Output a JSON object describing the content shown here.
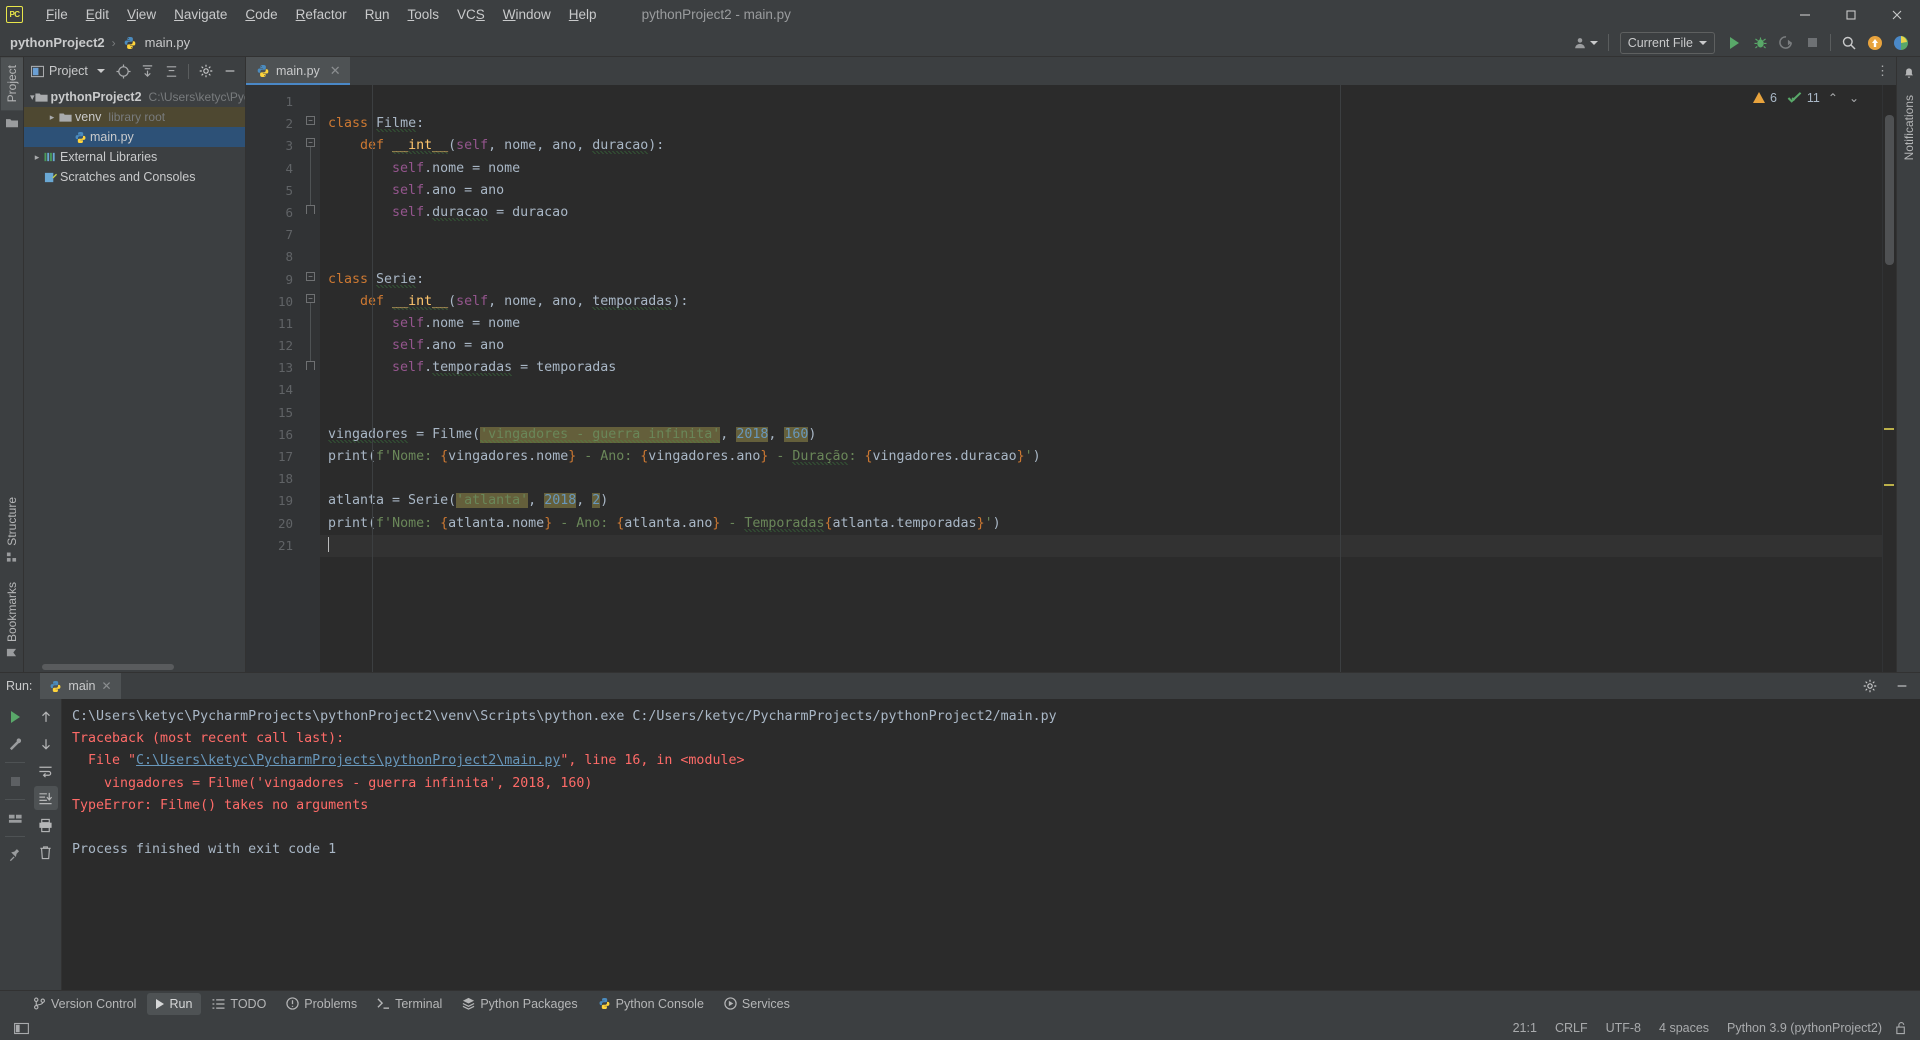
{
  "window": {
    "title": "pythonProject2 - main.py",
    "minimize_label": "–",
    "maximize_label": "❐",
    "close_label": "✕",
    "logo_text": "PC"
  },
  "menubar": {
    "items": [
      {
        "label": "File",
        "mnemonic": "F"
      },
      {
        "label": "Edit",
        "mnemonic": "E"
      },
      {
        "label": "View",
        "mnemonic": "V"
      },
      {
        "label": "Navigate",
        "mnemonic": "N"
      },
      {
        "label": "Code",
        "mnemonic": "C"
      },
      {
        "label": "Refactor",
        "mnemonic": "R"
      },
      {
        "label": "Run",
        "mnemonic": "u"
      },
      {
        "label": "Tools",
        "mnemonic": "T"
      },
      {
        "label": "VCS",
        "mnemonic": "S"
      },
      {
        "label": "Window",
        "mnemonic": "W"
      },
      {
        "label": "Help",
        "mnemonic": "H"
      }
    ]
  },
  "breadcrumb": {
    "project": "pythonProject2",
    "separator": "›",
    "file": "main.py"
  },
  "toolbar": {
    "run_configuration": "Current File",
    "buttons": [
      "run",
      "debug",
      "run-with-coverage",
      "stop",
      "search",
      "updates",
      "ide-feature"
    ]
  },
  "left_rail": {
    "project_tab": "Project",
    "structure_tab": "Structure",
    "bookmarks_tab": "Bookmarks"
  },
  "right_rail": {
    "notifications_tab": "Notifications"
  },
  "project_panel": {
    "title": "Project",
    "tree": [
      {
        "label": "pythonProject2",
        "hint": "C:\\Users\\ketyc\\Pycharm",
        "indent": 0,
        "twisty": "expanded",
        "icon": "folder-icon",
        "bold": true,
        "state": "none"
      },
      {
        "label": "venv",
        "hint": "library root",
        "indent": 1,
        "twisty": "collapsed",
        "icon": "folder-icon",
        "bold": false,
        "state": "venv"
      },
      {
        "label": "main.py",
        "hint": "",
        "indent": 2,
        "twisty": "none",
        "icon": "python-file-icon",
        "bold": false,
        "state": "selected"
      },
      {
        "label": "External Libraries",
        "hint": "",
        "indent": 0,
        "twisty": "collapsed",
        "icon": "libraries-icon",
        "bold": false,
        "state": "none"
      },
      {
        "label": "Scratches and Consoles",
        "hint": "",
        "indent": 0,
        "twisty": "none",
        "icon": "scratches-icon",
        "bold": false,
        "state": "none"
      }
    ]
  },
  "editor": {
    "tab": {
      "label": "main.py",
      "close": "✕"
    },
    "inspections": {
      "warning_count": "6",
      "ok_count": "11",
      "up": "⌃",
      "down": "⌄"
    },
    "lines": [
      {
        "n": "1",
        "html": ""
      },
      {
        "n": "2",
        "html": "<span class=\"kw\">class</span> <span class=\"cls sq\">Filme</span>:"
      },
      {
        "n": "3",
        "html": "    <span class=\"kw\">def</span> <span class=\"fn sq\">__int__</span>(<span class=\"self\">self</span>, nome, ano, <span class=\"sq\">duracao</span>):"
      },
      {
        "n": "4",
        "html": "        <span class=\"self\">self</span>.nome = nome"
      },
      {
        "n": "5",
        "html": "        <span class=\"self\">self</span>.ano = ano"
      },
      {
        "n": "6",
        "html": "        <span class=\"self\">self</span>.<span class=\"sq\">duracao</span> = duracao"
      },
      {
        "n": "7",
        "html": ""
      },
      {
        "n": "8",
        "html": ""
      },
      {
        "n": "9",
        "html": "<span class=\"kw\">class</span> <span class=\"cls sq\">Serie</span>:"
      },
      {
        "n": "10",
        "html": "    <span class=\"kw\">def</span> <span class=\"fn sq\">__int__</span>(<span class=\"self\">self</span>, nome, ano, <span class=\"sq\">temporadas</span>):"
      },
      {
        "n": "11",
        "html": "        <span class=\"self\">self</span>.nome = nome"
      },
      {
        "n": "12",
        "html": "        <span class=\"self\">self</span>.ano = ano"
      },
      {
        "n": "13",
        "html": "        <span class=\"self\">self</span>.<span class=\"sq\">temporadas</span> = temporadas"
      },
      {
        "n": "14",
        "html": ""
      },
      {
        "n": "15",
        "html": ""
      },
      {
        "n": "16",
        "html": "<span class=\"sq\">vingadores</span> = Filme(<span class=\"str hl sq\">'vingadores - guerra infinita'</span><span class=\"punc\">,</span> <span class=\"num hl\">2018</span><span class=\"punc\">,</span> <span class=\"num hl\">160</span>)"
      },
      {
        "n": "17",
        "html": "print(<span class=\"str\">f'</span><span class=\"str\">Nome: </span><span class=\"fstr-brace\">{</span>vingadores.nome<span class=\"fstr-brace\">}</span><span class=\"str\"> - Ano: </span><span class=\"fstr-brace\">{</span>vingadores.ano<span class=\"fstr-brace\">}</span><span class=\"str\"> - </span><span class=\"str sq\">Duração</span><span class=\"str\">: </span><span class=\"fstr-brace\">{</span>vingadores.duracao<span class=\"fstr-brace\">}</span><span class=\"str\">'</span>)"
      },
      {
        "n": "18",
        "html": ""
      },
      {
        "n": "19",
        "html": "atlanta = Serie(<span class=\"str hl\">'atlanta'</span><span class=\"punc\">,</span> <span class=\"num hl\">2018</span><span class=\"punc\">,</span> <span class=\"num hl\">2</span>)"
      },
      {
        "n": "20",
        "html": "print(<span class=\"str\">f'</span><span class=\"str\">Nome: </span><span class=\"fstr-brace\">{</span>atlanta.nome<span class=\"fstr-brace\">}</span><span class=\"str\"> - Ano: </span><span class=\"fstr-brace\">{</span>atlanta.ano<span class=\"fstr-brace\">}</span><span class=\"str\"> - </span><span class=\"str sq\">Temporadas</span><span class=\"fstr-brace\">{</span>atlanta.temporadas<span class=\"fstr-brace\">}</span><span class=\"str\">'</span>)"
      },
      {
        "n": "21",
        "html": "",
        "current": true
      }
    ]
  },
  "run_window": {
    "label": "Run:",
    "tab": "main",
    "tab_close": "✕",
    "settings_icon": "gear-icon",
    "minimize_icon": "minimize-icon",
    "console": [
      {
        "text": "C:\\Users\\ketyc\\PycharmProjects\\pythonProject2\\venv\\Scripts\\python.exe C:/Users/ketyc/PycharmProjects/pythonProject2/main.py",
        "type": "normal"
      },
      {
        "text": "Traceback (most recent call last):",
        "type": "error"
      },
      {
        "text": "  File \"C:\\Users\\ketyc\\PycharmProjects\\pythonProject2\\main.py\", line 16, in <module>",
        "type": "error-link",
        "prefix": "  File \"",
        "link": "C:\\Users\\ketyc\\PycharmProjects\\pythonProject2\\main.py",
        "suffix": "\", line 16, in <module>"
      },
      {
        "text": "    vingadores = Filme('vingadores - guerra infinita', 2018, 160)",
        "type": "error"
      },
      {
        "text": "TypeError: Filme() takes no arguments",
        "type": "error"
      },
      {
        "text": "",
        "type": "normal"
      },
      {
        "text": "Process finished with exit code 1",
        "type": "normal"
      }
    ]
  },
  "tool_window_bar": {
    "items": [
      {
        "label": "Version Control",
        "icon": "branch-icon",
        "active": false
      },
      {
        "label": "Run",
        "icon": "run-icon",
        "active": true
      },
      {
        "label": "TODO",
        "icon": "todo-icon",
        "active": false
      },
      {
        "label": "Problems",
        "icon": "problems-icon",
        "active": false
      },
      {
        "label": "Terminal",
        "icon": "terminal-icon",
        "active": false
      },
      {
        "label": "Python Packages",
        "icon": "packages-icon",
        "active": false
      },
      {
        "label": "Python Console",
        "icon": "python-icon",
        "active": false
      },
      {
        "label": "Services",
        "icon": "services-icon",
        "active": false
      }
    ]
  },
  "statusbar": {
    "caret_position": "21:1",
    "line_separator": "CRLF",
    "encoding": "UTF-8",
    "indent": "4 spaces",
    "interpreter": "Python 3.9 (pythonProject2)",
    "lock_icon": "unlocked-icon"
  }
}
